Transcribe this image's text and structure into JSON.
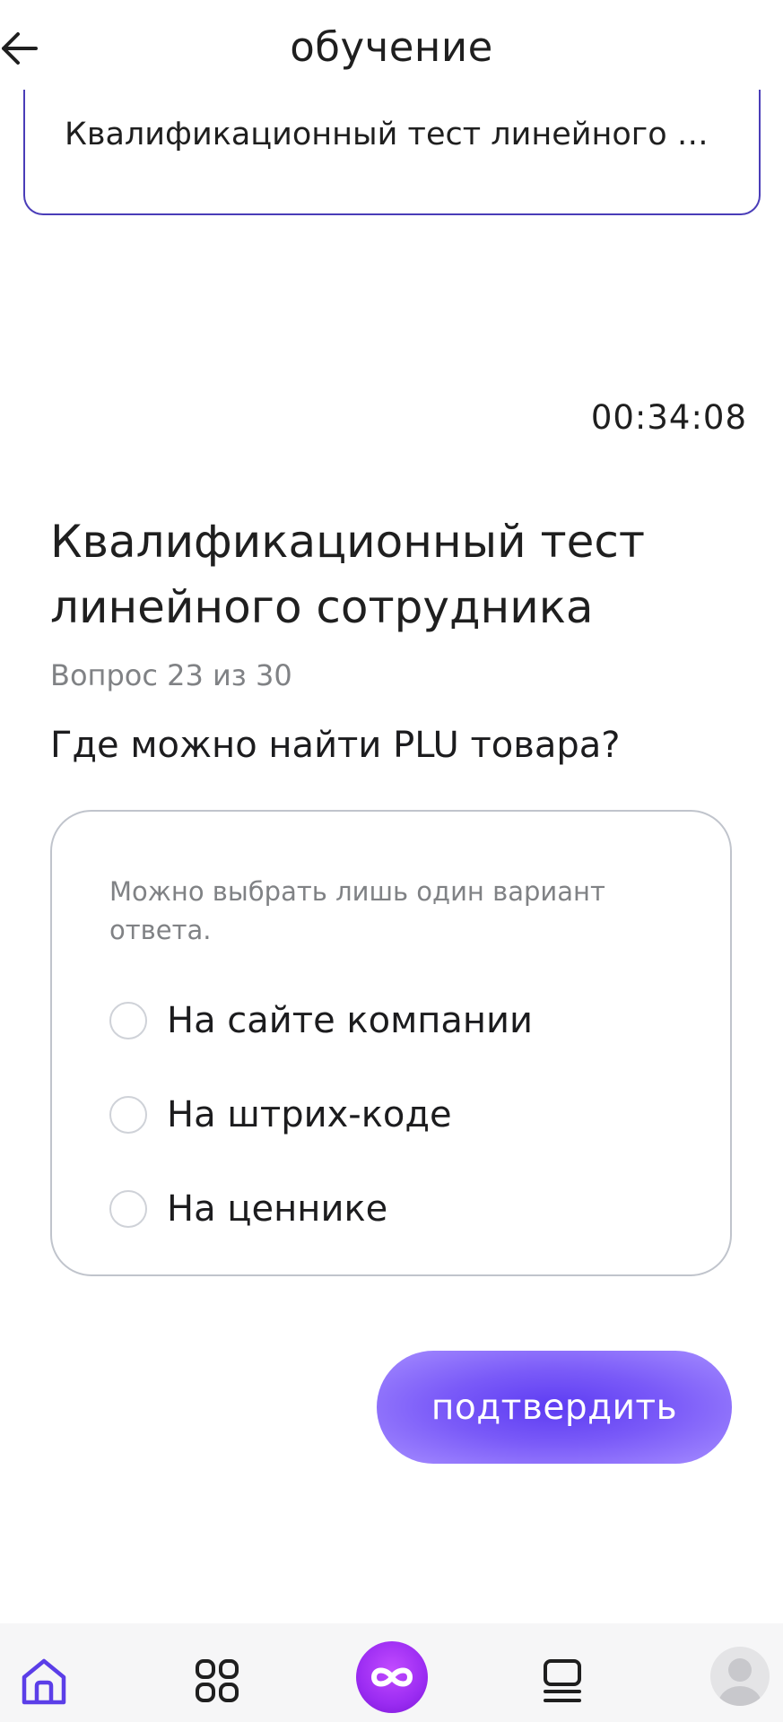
{
  "header": {
    "title": "обучение",
    "back_icon": "arrow-left-icon"
  },
  "top_card": {
    "text": "Квалификационный тест линейного с..."
  },
  "timer": "00:34:08",
  "test": {
    "title": "Квалификационный тест линейного сотрудника",
    "counter": "Вопрос 23 из 30",
    "question": "Где можно найти PLU товара?",
    "hint": "Можно выбрать лишь один вариант ответа.",
    "options": [
      {
        "label": "На сайте компании"
      },
      {
        "label": "На штрих-коде"
      },
      {
        "label": "На ценнике"
      }
    ]
  },
  "confirm_label": "подтвердить",
  "colors": {
    "accent": "#6a4cf5",
    "card_border": "#4a3db8",
    "muted_text": "#808285",
    "center_nav": "#9b2cf2"
  },
  "bottom_nav": {
    "items": [
      {
        "icon": "home-icon"
      },
      {
        "icon": "grid-icon"
      },
      {
        "icon": "infinity-icon"
      },
      {
        "icon": "list-icon"
      },
      {
        "icon": "avatar-icon"
      }
    ]
  }
}
